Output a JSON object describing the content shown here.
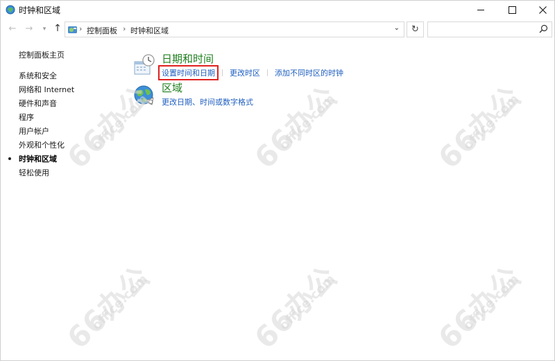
{
  "window": {
    "title": "时钟和区域"
  },
  "address_bar": {
    "crumbs": [
      "控制面板",
      "时钟和区域"
    ],
    "search_placeholder": ""
  },
  "sidebar": {
    "home": "控制面板主页",
    "items": [
      {
        "label": "系统和安全",
        "active": false
      },
      {
        "label": "网络和 Internet",
        "active": false
      },
      {
        "label": "硬件和声音",
        "active": false
      },
      {
        "label": "程序",
        "active": false
      },
      {
        "label": "用户帐户",
        "active": false
      },
      {
        "label": "外观和个性化",
        "active": false
      },
      {
        "label": "时钟和区域",
        "active": true
      },
      {
        "label": "轻松使用",
        "active": false
      }
    ]
  },
  "categories": [
    {
      "title": "日期和时间",
      "icon": "date-time-icon",
      "links": [
        "设置时间和日期",
        "更改时区",
        "添加不同时区的时钟"
      ],
      "highlighted_link": 0
    },
    {
      "title": "区域",
      "icon": "globe-icon",
      "links": [
        "更改日期、时间或数字格式"
      ]
    }
  ],
  "watermark": {
    "brand": "66办公",
    "domain": "office.com"
  },
  "colors": {
    "category_title": "#1e7e1e",
    "link": "#1f5fbf",
    "highlight_box": "#e02020"
  }
}
